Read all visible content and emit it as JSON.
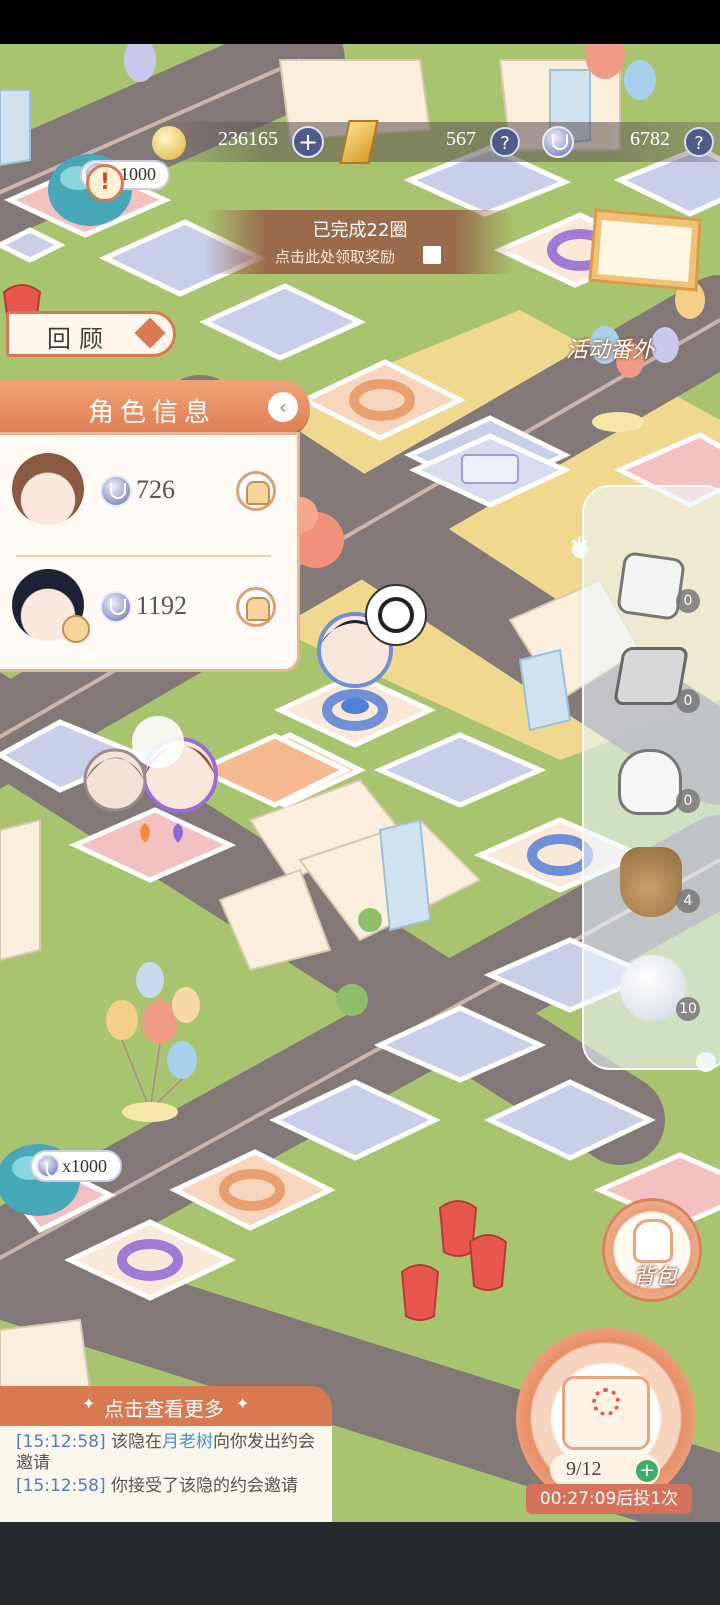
{
  "resources": {
    "gold": "236165",
    "gem": "567",
    "token": "6782",
    "help_glyph": "?",
    "add_glyph": "+"
  },
  "board_reward": {
    "top_label": "1000",
    "bottom_label": "x1000",
    "alert_glyph": "!"
  },
  "banner": {
    "title": "已完成22圈",
    "subtitle": "点击此处领取奖励"
  },
  "event": {
    "label": "活动番外"
  },
  "review": {
    "label": "回顾"
  },
  "role_panel": {
    "title": "角色信息",
    "roles": [
      {
        "points": "726"
      },
      {
        "points": "1192"
      }
    ]
  },
  "items": [
    {
      "icon": "dice-icon",
      "count": "0"
    },
    {
      "icon": "broken-dice-icon",
      "count": "0"
    },
    {
      "icon": "glove-icon",
      "count": "0"
    },
    {
      "icon": "sack-icon",
      "count": "4"
    },
    {
      "icon": "snowball-icon",
      "count": "10"
    }
  ],
  "backpack": {
    "label": "背包"
  },
  "dice": {
    "quota": "9/12",
    "countdown": "00:27:09后投1次"
  },
  "log": {
    "header": "点击查看更多",
    "lines": [
      {
        "time": "[15:12:58]",
        "pre": "该隐在",
        "place": "月老树",
        "post": "向你发出约会邀请"
      },
      {
        "time": "[15:12:58]",
        "pre": "你接受了该隐的约会邀请",
        "place": "",
        "post": ""
      }
    ]
  },
  "colors": {
    "accent": "#d97952",
    "tile_blue": "#c8cfe8",
    "grass": "#a9c46f",
    "road": "#7f7478",
    "token_blue": "#6f7bb8"
  }
}
